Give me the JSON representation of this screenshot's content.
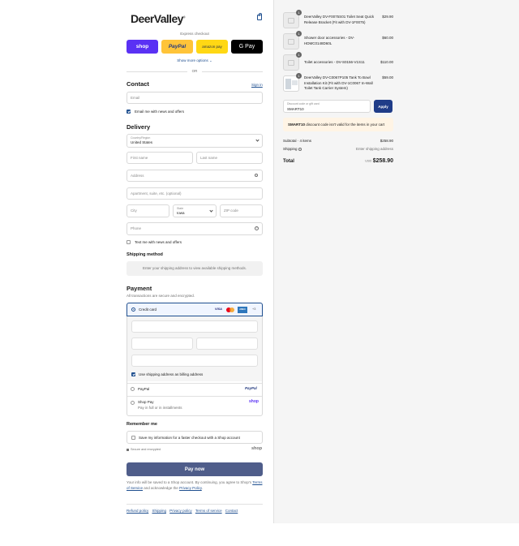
{
  "brand": {
    "name": "DeerValley",
    "mark": "®"
  },
  "express": {
    "label": "Express checkout",
    "buttons": {
      "shop": "shop",
      "paypal": "PayPal",
      "amazon": "amazon pay",
      "gpay": "G Pay"
    },
    "more_options": "Show more options ⌄",
    "or": "OR"
  },
  "contact": {
    "heading": "Contact",
    "sign_in": "Sign in",
    "email_placeholder": "Email",
    "news_offers": "Email me with news and offers"
  },
  "delivery": {
    "heading": "Delivery",
    "country_label": "Country/Region",
    "country_value": "United States",
    "first_name": "First name",
    "last_name": "Last name",
    "address": "Address",
    "apartment": "Apartment, suite, etc. (optional)",
    "city": "City",
    "state_label": "State",
    "state_value": "Iowa",
    "zip": "ZIP code",
    "phone": "Phone",
    "text_me": "Text me with news and offers"
  },
  "shipping": {
    "heading": "Shipping method",
    "message": "Enter your shipping address to view available shipping methods."
  },
  "payment": {
    "heading": "Payment",
    "subtext": "All transactions are secure and encrypted.",
    "credit_card": "Credit card",
    "card_brands": [
      "VISA",
      "●●",
      "AMEX",
      "+3"
    ],
    "billing_same": "Use shipping address as billing address",
    "paypal": "PayPal",
    "paypal_logo": "PayPal",
    "shop_pay": "Shop Pay",
    "shop_pay_sub": "Pay in full or in installments",
    "shop_logo": "shop"
  },
  "remember": {
    "heading": "Remember me",
    "save_info": "Save my information for a faster checkout with a Shop account",
    "secure": "Secure and encrypted",
    "shop_logo": "shop"
  },
  "pay_now": "Pay now",
  "legal": {
    "text1": "Your info will be saved to a Shop account. By continuing, you agree to Shop's",
    "terms": "Terms of Service",
    "text2": "and acknowledge the",
    "privacy": "Privacy Policy",
    "period": "."
  },
  "footer_links": [
    "Refund policy",
    "Shipping",
    "Privacy policy",
    "Terms of service",
    "Contact"
  ],
  "cart": {
    "items": [
      {
        "qty": "1",
        "name": "DeerValley DV-F0075S01 Toilet Seat Quick Release Bracket (Fit with DV-1F0075)",
        "price": "$29.90"
      },
      {
        "qty": "1",
        "name": "Shower door accessories - DV-HDMC0148D60L",
        "price": "$60.00"
      },
      {
        "qty": "1",
        "name": "Toilet accessories - DV-S0156-V1S11",
        "price": "$110.00"
      },
      {
        "qty": "1",
        "name": "DeerValley DV-C0067P105 Tank To Bowl Installation Kit (Fit with DV-1C0067 In-Wall Toilet Tank Carrier System)",
        "price": "$59.00"
      }
    ],
    "discount_label": "Discount code or gift card",
    "discount_value": "SMART10",
    "apply": "Apply",
    "error_code": "SMART10",
    "error_text": "discount code isn't valid for the items in your cart",
    "subtotal_label": "Subtotal · 4 items",
    "subtotal_value": "$258.90",
    "shipping_label": "Shipping",
    "shipping_value": "Enter shipping address",
    "total_label": "Total",
    "currency": "USD",
    "total_value": "$258.90"
  },
  "colors": {
    "accent": "#1f4f8f",
    "paynow": "#4f5d8a",
    "shop": "#5a31f4",
    "paypal": "#ffc439",
    "amazon": "#ffd814"
  }
}
